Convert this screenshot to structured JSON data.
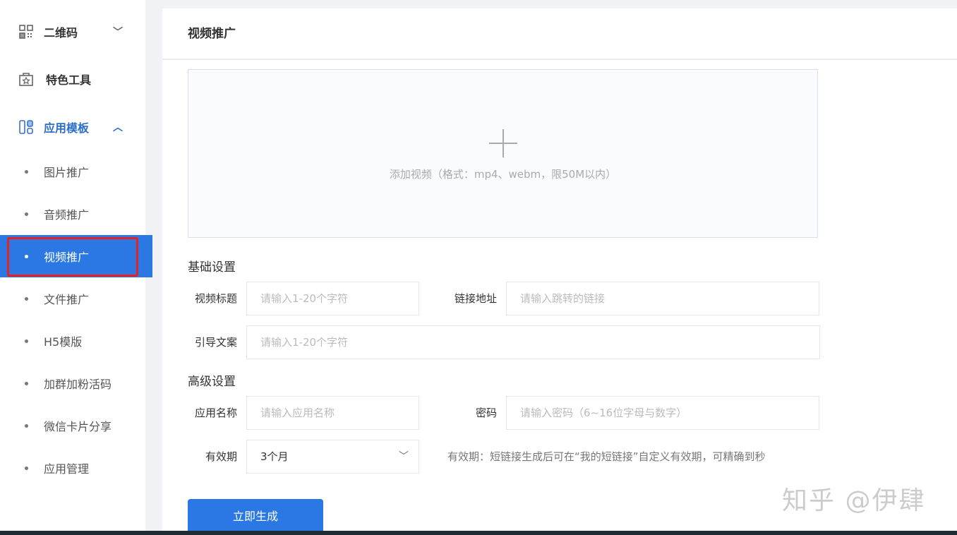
{
  "sidebar": {
    "menus": [
      {
        "label": "二维码",
        "icon": "qrcode-icon",
        "expanded": false
      },
      {
        "label": "特色工具",
        "icon": "toolbox-icon"
      },
      {
        "label": "应用模板",
        "icon": "template-icon",
        "expanded": true
      }
    ],
    "items": [
      {
        "label": "图片推广"
      },
      {
        "label": "音频推广"
      },
      {
        "label": "视频推广"
      },
      {
        "label": "文件推广"
      },
      {
        "label": "H5模版"
      },
      {
        "label": "加群加粉活码"
      },
      {
        "label": "微信卡片分享"
      },
      {
        "label": "应用管理"
      }
    ],
    "active_color": "#2b78e4"
  },
  "main": {
    "title": "视频推广",
    "upload_text": "添加视频（格式：mp4、webm，限50M以内）",
    "basic_title": "基础设置",
    "video_title_label": "视频标题",
    "video_title_placeholder": "请输入1-20个字符",
    "link_label": "链接地址",
    "link_placeholder": "请输入跳转的链接",
    "guide_label": "引导文案",
    "guide_placeholder": "请输入1-20个字符",
    "advanced_title": "高级设置",
    "app_name_label": "应用名称",
    "app_name_placeholder": "请输入应用名称",
    "password_label": "密码",
    "password_placeholder": "请输入密码（6~16位字母与数字）",
    "validity_label": "有效期",
    "validity_value": "3个月",
    "validity_hint": "有效期：短链接生成后可在“我的短链接”自定义有效期，可精确到秒",
    "submit_label": "立即生成"
  },
  "watermark": "知乎 @伊肆"
}
